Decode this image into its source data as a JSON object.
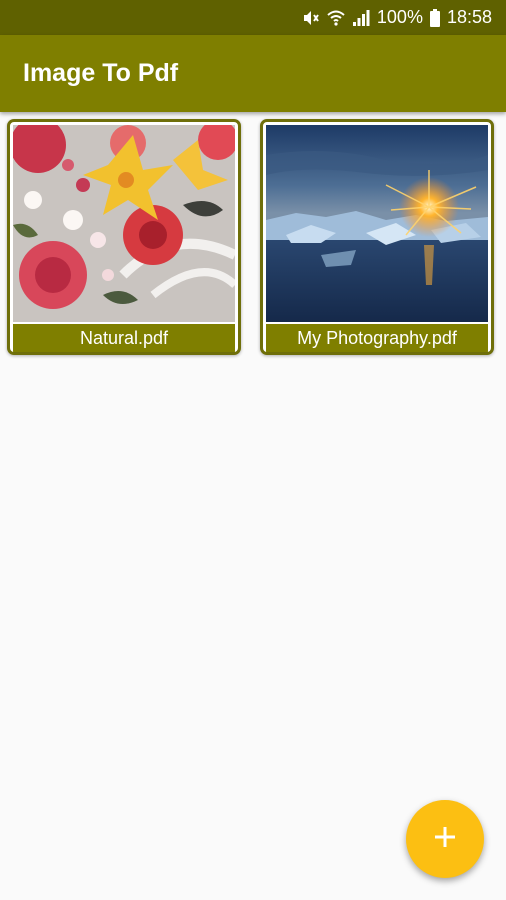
{
  "status_bar": {
    "battery_percent": "100%",
    "time": "18:58",
    "icons": [
      "mute-icon",
      "wifi-icon",
      "signal-icon",
      "battery-icon"
    ]
  },
  "app_bar": {
    "title": "Image To Pdf"
  },
  "documents": [
    {
      "name": "Natural.pdf",
      "thumbnail": "flowers"
    },
    {
      "name": "My Photography.pdf",
      "thumbnail": "sunset-ice"
    }
  ],
  "fab": {
    "icon": "plus-icon"
  },
  "colors": {
    "status_bar": "#5f6100",
    "app_bar": "#7f7f00",
    "fab": "#fcbf12",
    "background": "#fafafa"
  }
}
